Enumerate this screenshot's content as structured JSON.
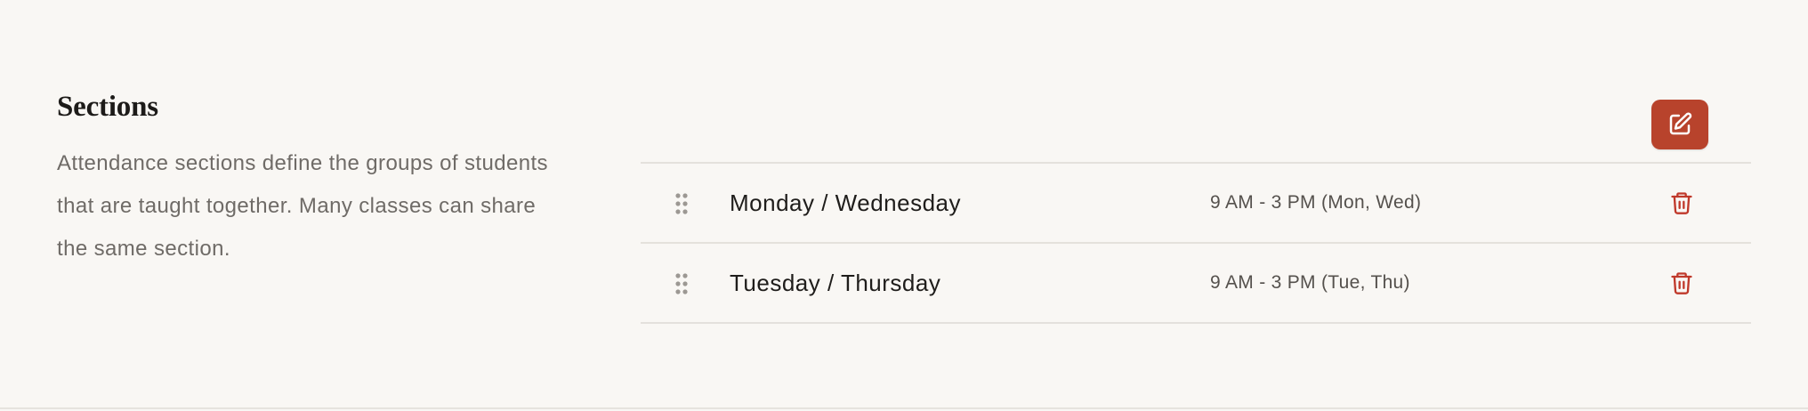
{
  "section": {
    "title": "Sections",
    "description": "Attendance sections define the groups of students that are taught together. Many classes can share the same section."
  },
  "actions": {
    "edit_icon": "edit-square-icon",
    "delete_icon": "trash-icon",
    "drag_icon": "drag-handle-icon"
  },
  "colors": {
    "accent": "#b8432c",
    "delete": "#c0392b",
    "background": "#f9f7f4"
  },
  "rows": [
    {
      "name": "Monday / Wednesday",
      "schedule": "9 AM - 3 PM (Mon, Wed)"
    },
    {
      "name": "Tuesday / Thursday",
      "schedule": "9 AM - 3 PM (Tue, Thu)"
    }
  ]
}
